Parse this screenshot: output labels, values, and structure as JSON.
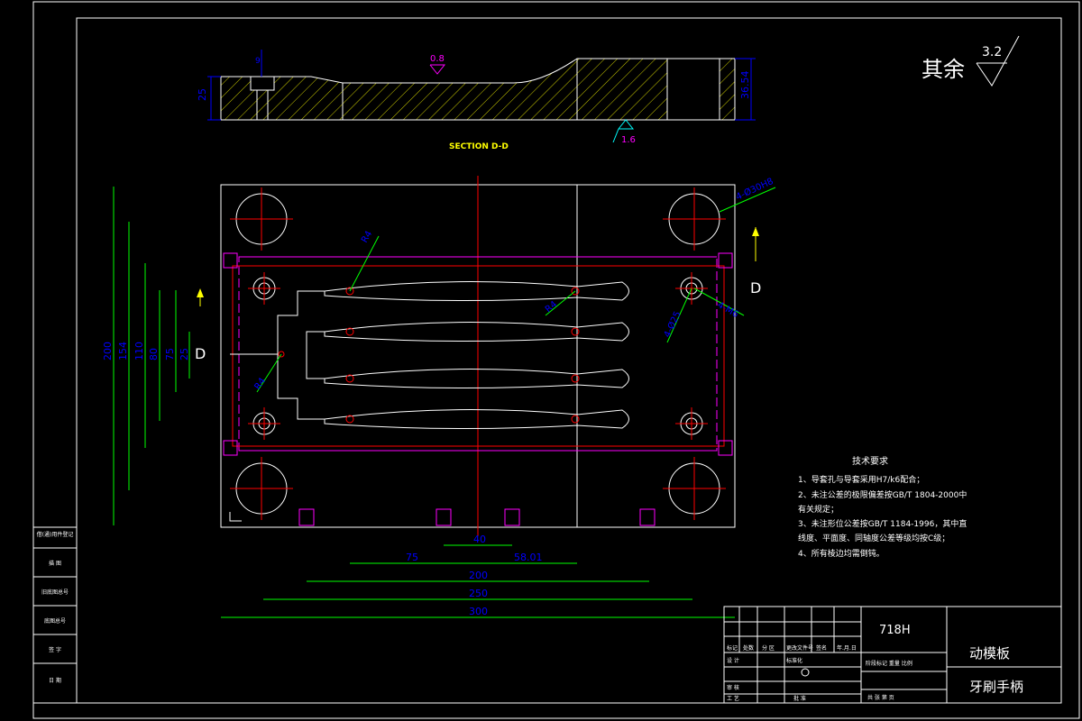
{
  "roughness_note": {
    "label": "其余",
    "value": "3.2"
  },
  "section": {
    "label": "SECTION D-D",
    "dims": {
      "height_left": "25",
      "height_right": "36.54",
      "top_small": "9"
    },
    "roughness": {
      "top": "0.8",
      "bottom": "1.6"
    }
  },
  "plan": {
    "section_mark": "D",
    "dims": {
      "bottom": [
        "40",
        "75",
        "58.01",
        "200",
        "250",
        "300"
      ],
      "left": [
        "200",
        "154",
        "110",
        "80",
        "75",
        "25"
      ],
      "callouts": [
        "R4",
        "4-Ø30H8",
        "4-Ø25",
        "R4",
        "R4",
        "4-M6"
      ]
    }
  },
  "tech_requirements": {
    "title": "技术要求",
    "lines": [
      "1、导套孔与导套采用H7/k6配合；",
      "2、未注公差的极限偏差按GB/T 1804-2000中",
      "    有关规定；",
      "3、未注形位公差按GB/T 1184-1996，其中直",
      "    线度、平面度、同轴度公差等级均按C级；",
      "4、所有棱边均需倒钝。"
    ]
  },
  "title_block": {
    "material": "718H",
    "part_name": "动模板",
    "drawing_name": "牙刷手柄",
    "headers": [
      "标记",
      "处数",
      "分  区",
      "更改文件号",
      "签名",
      "年.月.日"
    ],
    "rows": [
      "设  计",
      "标准化",
      "审  核",
      "工  艺",
      "批  准"
    ],
    "stage_label": "阶段标记  重量  比例",
    "sheet_label": "共    张    第    页"
  },
  "left_strip": {
    "items": [
      "借(通)用件登记",
      "旧底图总号",
      "描  图",
      "底图总号",
      "签  字",
      "日  期"
    ]
  },
  "colors": {
    "background": "#000000",
    "frame": "#ffffff",
    "dimension": "#0000ff",
    "center_line": "#ff0000",
    "hidden_line": "#ff00ff",
    "hatch": "#ffff00",
    "leader": "#00ff00"
  }
}
